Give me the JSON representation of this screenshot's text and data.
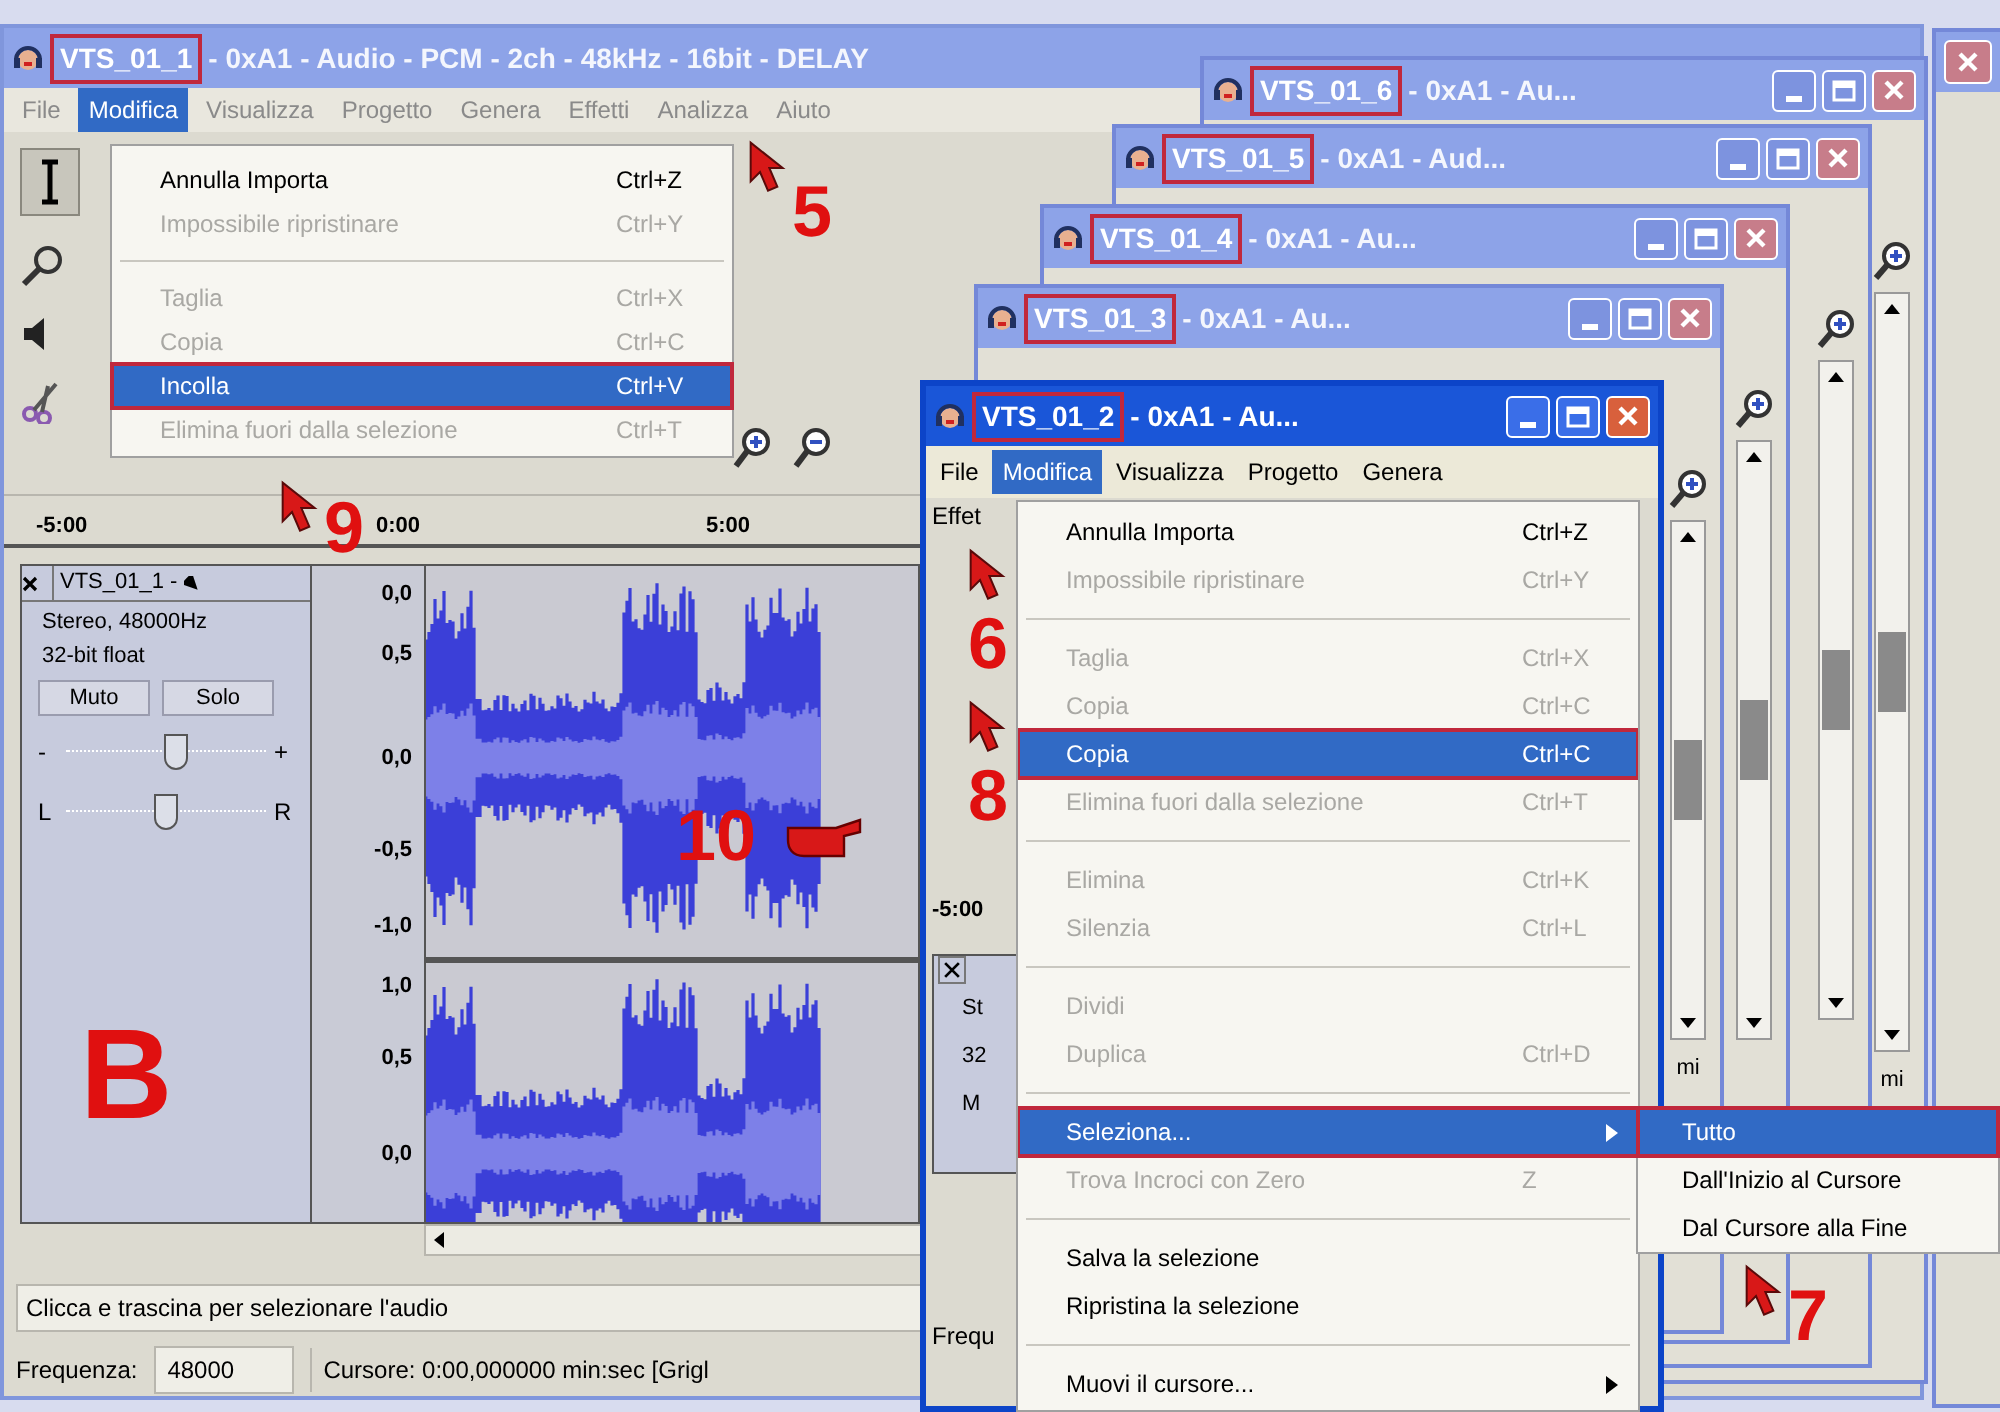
{
  "main_window": {
    "title_name": "VTS_01_1",
    "title_rest": "- 0xA1 - Audio - PCM - 2ch - 48kHz - 16bit - DELAY",
    "menu": [
      {
        "label": "File",
        "selected": false
      },
      {
        "label": "Modifica",
        "selected": true
      },
      {
        "label": "Visualizza",
        "selected": false
      },
      {
        "label": "Progetto",
        "selected": false
      },
      {
        "label": "Genera",
        "selected": false
      },
      {
        "label": "Effetti",
        "selected": false
      },
      {
        "label": "Analizza",
        "selected": false
      },
      {
        "label": "Aiuto",
        "selected": false
      }
    ],
    "edit_menu": [
      {
        "kind": "item",
        "label": "Annulla Importa",
        "shortcut": "Ctrl+Z",
        "disabled": false,
        "selected": false
      },
      {
        "kind": "item",
        "label": "Impossibile ripristinare",
        "shortcut": "Ctrl+Y",
        "disabled": true,
        "selected": false
      },
      {
        "kind": "separator"
      },
      {
        "kind": "item",
        "label": "Taglia",
        "shortcut": "Ctrl+X",
        "disabled": true,
        "selected": false
      },
      {
        "kind": "item",
        "label": "Copia",
        "shortcut": "Ctrl+C",
        "disabled": true,
        "selected": false
      },
      {
        "kind": "item",
        "label": "Incolla",
        "shortcut": "Ctrl+V",
        "disabled": false,
        "selected": true
      },
      {
        "kind": "item",
        "label": "Elimina fuori dalla selezione",
        "shortcut": "Ctrl+T",
        "disabled": true,
        "selected": false
      }
    ],
    "ruler": [
      "-5:00",
      "0:00",
      "5:00"
    ],
    "track": {
      "name": "VTS_01_1 -",
      "format": "Stereo, 48000Hz",
      "sample": "32-bit float",
      "buttons": [
        "Muto",
        "Solo"
      ],
      "gain": {
        "min_label": "-",
        "max_label": "+",
        "level": 0.55
      },
      "pan": {
        "min_label": "L",
        "max_label": "R",
        "level": 0.5
      },
      "axis": [
        "0,0",
        "0,5",
        "0,0",
        "-0,5",
        "-1,0",
        "1,0",
        "0,5",
        "0,0"
      ]
    },
    "status_message": "Clicca e trascina per selezionare l'audio",
    "rate_label": "Frequenza:",
    "rate_value": "48000",
    "cursor_text": "Cursore: 0:00,000000 min:sec [Grigl"
  },
  "background_windows": [
    {
      "title_name": "VTS_01_6",
      "title_rest": "- 0xA1 - Au...",
      "body_text": "mi"
    },
    {
      "title_name": "VTS_01_5",
      "title_rest": "- 0xA1 - Aud..."
    },
    {
      "title_name": "VTS_01_4",
      "title_rest": "- 0xA1 - Au..."
    },
    {
      "title_name": "VTS_01_3",
      "title_rest": "- 0xA1 - Au...",
      "body_text": "mi"
    }
  ],
  "front_window": {
    "title_name": "VTS_01_2",
    "title_rest": "- 0xA1 - Au...",
    "menu": [
      {
        "label": "File",
        "selected": false
      },
      {
        "label": "Modifica",
        "selected": true
      },
      {
        "label": "Visualizza",
        "selected": false
      },
      {
        "label": "Progetto",
        "selected": false
      },
      {
        "label": "Genera",
        "selected": false
      }
    ],
    "menu_row2": "Effet",
    "ruler_label": "-5:00",
    "track_fragment": [
      "St",
      "32",
      "M"
    ],
    "status_label": "Frequ",
    "edit_menu": [
      {
        "kind": "item",
        "label": "Annulla Importa",
        "shortcut": "Ctrl+Z",
        "disabled": false,
        "selected": false
      },
      {
        "kind": "item",
        "label": "Impossibile ripristinare",
        "shortcut": "Ctrl+Y",
        "disabled": true,
        "selected": false
      },
      {
        "kind": "separator"
      },
      {
        "kind": "item",
        "label": "Taglia",
        "shortcut": "Ctrl+X",
        "disabled": true,
        "selected": false
      },
      {
        "kind": "item",
        "label": "Copia",
        "shortcut": "Ctrl+C",
        "disabled": true,
        "selected": false
      },
      {
        "kind": "item",
        "label": "Copia",
        "shortcut": "Ctrl+C",
        "disabled": false,
        "selected": true
      },
      {
        "kind": "item",
        "label": "Elimina fuori dalla selezione",
        "shortcut": "Ctrl+T",
        "disabled": true,
        "selected": false
      },
      {
        "kind": "separator"
      },
      {
        "kind": "item",
        "label": "Elimina",
        "shortcut": "Ctrl+K",
        "disabled": true,
        "selected": false
      },
      {
        "kind": "item",
        "label": "Silenzia",
        "shortcut": "Ctrl+L",
        "disabled": true,
        "selected": false
      },
      {
        "kind": "separator"
      },
      {
        "kind": "item",
        "label": "Dividi",
        "disabled": true,
        "selected": false
      },
      {
        "kind": "item",
        "label": "Duplica",
        "shortcut": "Ctrl+D",
        "disabled": true,
        "selected": false
      },
      {
        "kind": "separator"
      },
      {
        "kind": "submenu",
        "label": "Seleziona...",
        "disabled": false,
        "selected": true
      },
      {
        "kind": "item",
        "label": "Trova Incroci con Zero",
        "shortcut": "Z",
        "disabled": true,
        "selected": false
      },
      {
        "kind": "separator"
      },
      {
        "kind": "item",
        "label": "Salva la selezione",
        "disabled": false,
        "selected": false
      },
      {
        "kind": "item",
        "label": "Ripristina la selezione",
        "disabled": false,
        "selected": false
      },
      {
        "kind": "separator"
      },
      {
        "kind": "submenu",
        "label": "Muovi il cursore...",
        "disabled": false,
        "selected": false
      }
    ],
    "submenu": [
      {
        "label": "Tutto",
        "selected": true
      },
      {
        "label": "Dall'Inizio al Cursore",
        "selected": false
      },
      {
        "label": "Dal Cursore alla Fine",
        "selected": false
      }
    ]
  },
  "annotations": [
    {
      "kind": "number",
      "text": "5"
    },
    {
      "kind": "number",
      "text": "9"
    },
    {
      "kind": "number",
      "text": "10"
    },
    {
      "kind": "letter",
      "text": "B"
    },
    {
      "kind": "number",
      "text": "6"
    },
    {
      "kind": "number",
      "text": "8"
    },
    {
      "kind": "number",
      "text": "7"
    }
  ]
}
